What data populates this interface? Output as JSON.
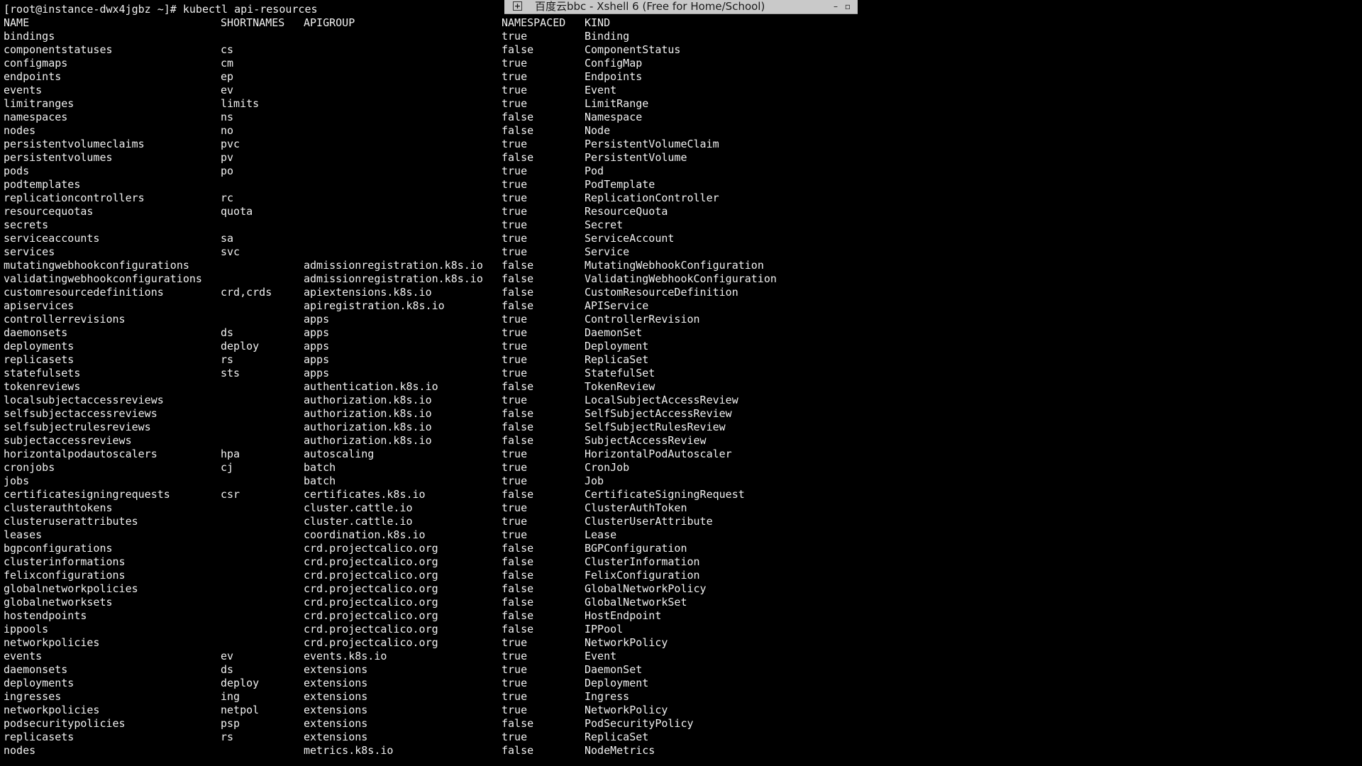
{
  "terminal": {
    "prompt": "[root@instance-dwx4jgbz ~]# kubectl api-resources",
    "headers": {
      "name": "NAME",
      "shortnames": "SHORTNAMES",
      "apigroup": "APIGROUP",
      "namespaced": "NAMESPACED",
      "kind": "KIND"
    },
    "rows": [
      [
        "bindings",
        "",
        "",
        "true",
        "Binding"
      ],
      [
        "componentstatuses",
        "cs",
        "",
        "false",
        "ComponentStatus"
      ],
      [
        "configmaps",
        "cm",
        "",
        "true",
        "ConfigMap"
      ],
      [
        "endpoints",
        "ep",
        "",
        "true",
        "Endpoints"
      ],
      [
        "events",
        "ev",
        "",
        "true",
        "Event"
      ],
      [
        "limitranges",
        "limits",
        "",
        "true",
        "LimitRange"
      ],
      [
        "namespaces",
        "ns",
        "",
        "false",
        "Namespace"
      ],
      [
        "nodes",
        "no",
        "",
        "false",
        "Node"
      ],
      [
        "persistentvolumeclaims",
        "pvc",
        "",
        "true",
        "PersistentVolumeClaim"
      ],
      [
        "persistentvolumes",
        "pv",
        "",
        "false",
        "PersistentVolume"
      ],
      [
        "pods",
        "po",
        "",
        "true",
        "Pod"
      ],
      [
        "podtemplates",
        "",
        "",
        "true",
        "PodTemplate"
      ],
      [
        "replicationcontrollers",
        "rc",
        "",
        "true",
        "ReplicationController"
      ],
      [
        "resourcequotas",
        "quota",
        "",
        "true",
        "ResourceQuota"
      ],
      [
        "secrets",
        "",
        "",
        "true",
        "Secret"
      ],
      [
        "serviceaccounts",
        "sa",
        "",
        "true",
        "ServiceAccount"
      ],
      [
        "services",
        "svc",
        "",
        "true",
        "Service"
      ],
      [
        "mutatingwebhookconfigurations",
        "",
        "admissionregistration.k8s.io",
        "false",
        "MutatingWebhookConfiguration"
      ],
      [
        "validatingwebhookconfigurations",
        "",
        "admissionregistration.k8s.io",
        "false",
        "ValidatingWebhookConfiguration"
      ],
      [
        "customresourcedefinitions",
        "crd,crds",
        "apiextensions.k8s.io",
        "false",
        "CustomResourceDefinition"
      ],
      [
        "apiservices",
        "",
        "apiregistration.k8s.io",
        "false",
        "APIService"
      ],
      [
        "controllerrevisions",
        "",
        "apps",
        "true",
        "ControllerRevision"
      ],
      [
        "daemonsets",
        "ds",
        "apps",
        "true",
        "DaemonSet"
      ],
      [
        "deployments",
        "deploy",
        "apps",
        "true",
        "Deployment"
      ],
      [
        "replicasets",
        "rs",
        "apps",
        "true",
        "ReplicaSet"
      ],
      [
        "statefulsets",
        "sts",
        "apps",
        "true",
        "StatefulSet"
      ],
      [
        "tokenreviews",
        "",
        "authentication.k8s.io",
        "false",
        "TokenReview"
      ],
      [
        "localsubjectaccessreviews",
        "",
        "authorization.k8s.io",
        "true",
        "LocalSubjectAccessReview"
      ],
      [
        "selfsubjectaccessreviews",
        "",
        "authorization.k8s.io",
        "false",
        "SelfSubjectAccessReview"
      ],
      [
        "selfsubjectrulesreviews",
        "",
        "authorization.k8s.io",
        "false",
        "SelfSubjectRulesReview"
      ],
      [
        "subjectaccessreviews",
        "",
        "authorization.k8s.io",
        "false",
        "SubjectAccessReview"
      ],
      [
        "horizontalpodautoscalers",
        "hpa",
        "autoscaling",
        "true",
        "HorizontalPodAutoscaler"
      ],
      [
        "cronjobs",
        "cj",
        "batch",
        "true",
        "CronJob"
      ],
      [
        "jobs",
        "",
        "batch",
        "true",
        "Job"
      ],
      [
        "certificatesigningrequests",
        "csr",
        "certificates.k8s.io",
        "false",
        "CertificateSigningRequest"
      ],
      [
        "clusterauthtokens",
        "",
        "cluster.cattle.io",
        "true",
        "ClusterAuthToken"
      ],
      [
        "clusteruserattributes",
        "",
        "cluster.cattle.io",
        "true",
        "ClusterUserAttribute"
      ],
      [
        "leases",
        "",
        "coordination.k8s.io",
        "true",
        "Lease"
      ],
      [
        "bgpconfigurations",
        "",
        "crd.projectcalico.org",
        "false",
        "BGPConfiguration"
      ],
      [
        "clusterinformations",
        "",
        "crd.projectcalico.org",
        "false",
        "ClusterInformation"
      ],
      [
        "felixconfigurations",
        "",
        "crd.projectcalico.org",
        "false",
        "FelixConfiguration"
      ],
      [
        "globalnetworkpolicies",
        "",
        "crd.projectcalico.org",
        "false",
        "GlobalNetworkPolicy"
      ],
      [
        "globalnetworksets",
        "",
        "crd.projectcalico.org",
        "false",
        "GlobalNetworkSet"
      ],
      [
        "hostendpoints",
        "",
        "crd.projectcalico.org",
        "false",
        "HostEndpoint"
      ],
      [
        "ippools",
        "",
        "crd.projectcalico.org",
        "false",
        "IPPool"
      ],
      [
        "networkpolicies",
        "",
        "crd.projectcalico.org",
        "true",
        "NetworkPolicy"
      ],
      [
        "events",
        "ev",
        "events.k8s.io",
        "true",
        "Event"
      ],
      [
        "daemonsets",
        "ds",
        "extensions",
        "true",
        "DaemonSet"
      ],
      [
        "deployments",
        "deploy",
        "extensions",
        "true",
        "Deployment"
      ],
      [
        "ingresses",
        "ing",
        "extensions",
        "true",
        "Ingress"
      ],
      [
        "networkpolicies",
        "netpol",
        "extensions",
        "true",
        "NetworkPolicy"
      ],
      [
        "podsecuritypolicies",
        "psp",
        "extensions",
        "false",
        "PodSecurityPolicy"
      ],
      [
        "replicasets",
        "rs",
        "extensions",
        "true",
        "ReplicaSet"
      ],
      [
        "nodes",
        "",
        "metrics.k8s.io",
        "false",
        "NodeMetrics"
      ]
    ]
  },
  "title_bar": {
    "icon": "pin-icon",
    "icon_glyph": "+",
    "text": "百度云bbc - Xshell 6 (Free for Home/School)",
    "minimize_glyph": "–",
    "restore_glyph": "▫"
  },
  "colors": {
    "background": "#000000",
    "text": "#f0f0f0",
    "title_bar_bg": "#c9c9c9"
  }
}
